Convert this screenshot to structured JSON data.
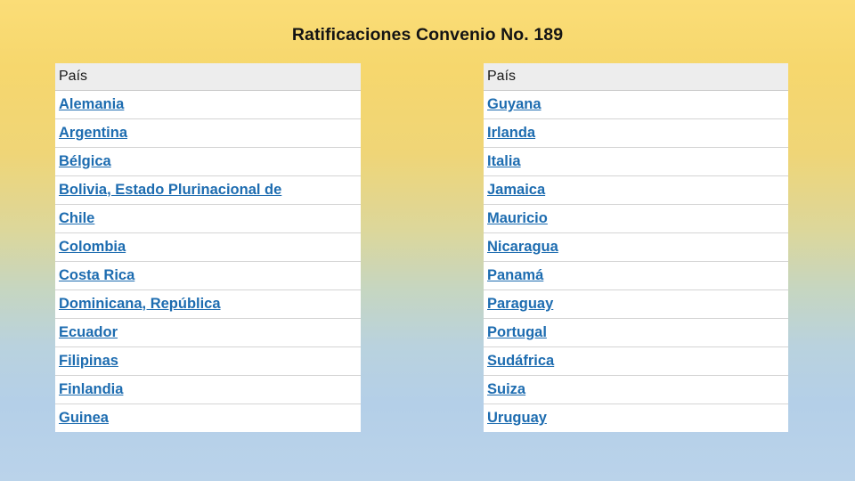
{
  "slide": {
    "title": "Ratificaciones Convenio No. 189",
    "background_top_color": "#fbdd77",
    "background_bottom_color": "#bad3ea",
    "title_color": "#141414"
  },
  "tables": {
    "left": {
      "header": "País",
      "link_color": "#1d6cb0",
      "header_bg": "#ededed",
      "rows": [
        "Alemania",
        "Argentina",
        "Bélgica",
        "Bolivia, Estado Plurinacional de",
        "Chile",
        "Colombia",
        "Costa Rica",
        "Dominicana, República",
        "Ecuador",
        "Filipinas",
        "Finlandia",
        "Guinea"
      ]
    },
    "right": {
      "header": "País",
      "link_color": "#1d6cb0",
      "header_bg": "#ededed",
      "rows": [
        "Guyana",
        "Irlanda",
        "Italia",
        "Jamaica",
        "Mauricio",
        "Nicaragua",
        "Panamá",
        "Paraguay",
        "Portugal",
        "Sudáfrica",
        "Suiza",
        "Uruguay"
      ]
    }
  }
}
